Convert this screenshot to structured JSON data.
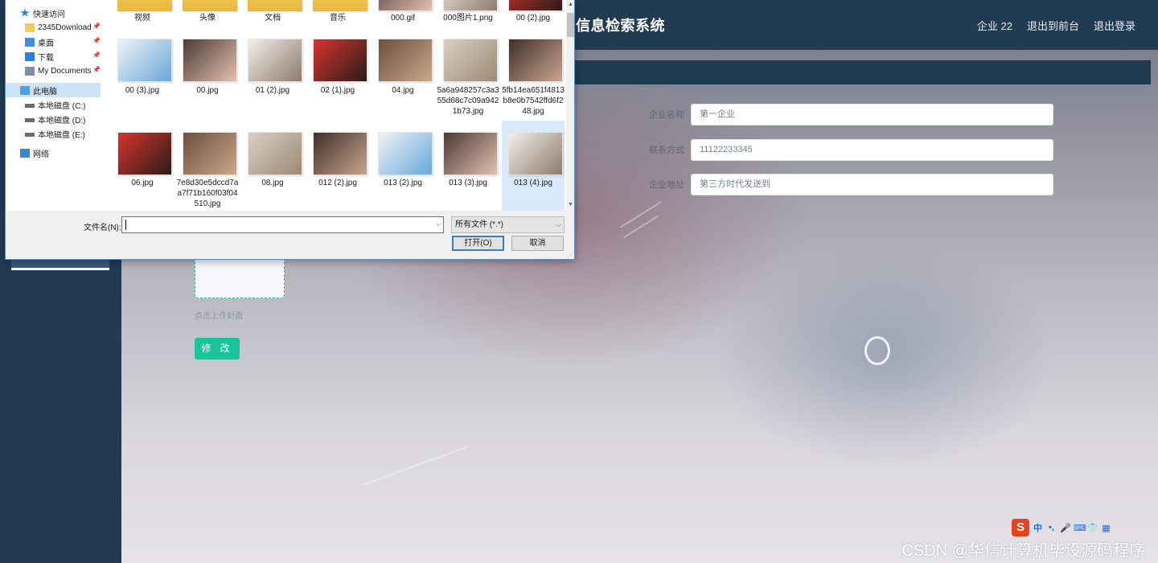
{
  "app": {
    "system_title": "信息检索系统",
    "top_nav": [
      {
        "label": "企业 22"
      },
      {
        "label": "退出到前台"
      },
      {
        "label": "退出登录"
      }
    ]
  },
  "sidebar": {
    "active_item": ""
  },
  "form": {
    "fields": [
      {
        "label": "企业名称",
        "value": "第一企业"
      },
      {
        "label": "联系方式",
        "value": "11122233345"
      },
      {
        "label": "企业地址",
        "value": "第三方时代发送到"
      }
    ],
    "upload_hint": "点击上传封面",
    "submit_label": "修 改"
  },
  "ime": {
    "logo": "S",
    "items": [
      "中",
      "•,",
      "🎤",
      "⌨",
      "👕",
      "▦"
    ]
  },
  "watermark": "CSDN @华信计算机毕设源码程序",
  "dialog": {
    "nav_items": [
      {
        "label": "快速访问",
        "icon": "star-icon",
        "pinned": false
      },
      {
        "label": "2345Download",
        "icon": "folder-icon",
        "pinned": true
      },
      {
        "label": "桌面",
        "icon": "desktop-icon",
        "pinned": true
      },
      {
        "label": "下载",
        "icon": "download-icon",
        "pinned": true
      },
      {
        "label": "My Documents",
        "icon": "documents-icon",
        "pinned": true
      },
      {
        "label": "此电脑",
        "icon": "computer-icon",
        "pinned": false
      },
      {
        "label": "本地磁盘 (C:)",
        "icon": "drive-icon",
        "pinned": false
      },
      {
        "label": "本地磁盘 (D:)",
        "icon": "drive-icon",
        "pinned": false
      },
      {
        "label": "本地磁盘 (E:)",
        "icon": "drive-icon",
        "pinned": false
      },
      {
        "label": "网络",
        "icon": "network-icon",
        "pinned": false
      }
    ],
    "files_row1": [
      {
        "name": "视频",
        "kind": "folder"
      },
      {
        "name": "头像",
        "kind": "folder"
      },
      {
        "name": "文档",
        "kind": "folder"
      },
      {
        "name": "音乐",
        "kind": "folder"
      },
      {
        "name": "000.gif",
        "kind": "image"
      },
      {
        "name": "000图片1.png",
        "kind": "image"
      },
      {
        "name": "00 (2).jpg",
        "kind": "image"
      }
    ],
    "files_row2": [
      {
        "name": "00 (3).jpg",
        "kind": "image"
      },
      {
        "name": "00.jpg",
        "kind": "image"
      },
      {
        "name": "01 (2).jpg",
        "kind": "image"
      },
      {
        "name": "02 (1).jpg",
        "kind": "image"
      },
      {
        "name": "04.jpg",
        "kind": "image"
      },
      {
        "name": "5a6a948257c3a355d68c7c09a9421b73.jpg",
        "kind": "image"
      },
      {
        "name": "5fb14ea651f4813b8e0b7542ffd6f248.jpg",
        "kind": "image"
      }
    ],
    "files_row3": [
      {
        "name": "06.jpg",
        "kind": "image"
      },
      {
        "name": "7e8d30e5dccd7aa7f71b160f03f04510.jpg",
        "kind": "image"
      },
      {
        "name": "08.jpg",
        "kind": "image"
      },
      {
        "name": "012 (2).jpg",
        "kind": "image"
      },
      {
        "name": "013 (2).jpg",
        "kind": "image"
      },
      {
        "name": "013 (3).jpg",
        "kind": "image"
      },
      {
        "name": "013 (4).jpg",
        "kind": "image",
        "selected": true
      }
    ],
    "filename_label": "文件名(N):",
    "filename_value": "",
    "filetype_value": "所有文件 (*.*)",
    "open_label": "打开(O)",
    "cancel_label": "取消"
  }
}
